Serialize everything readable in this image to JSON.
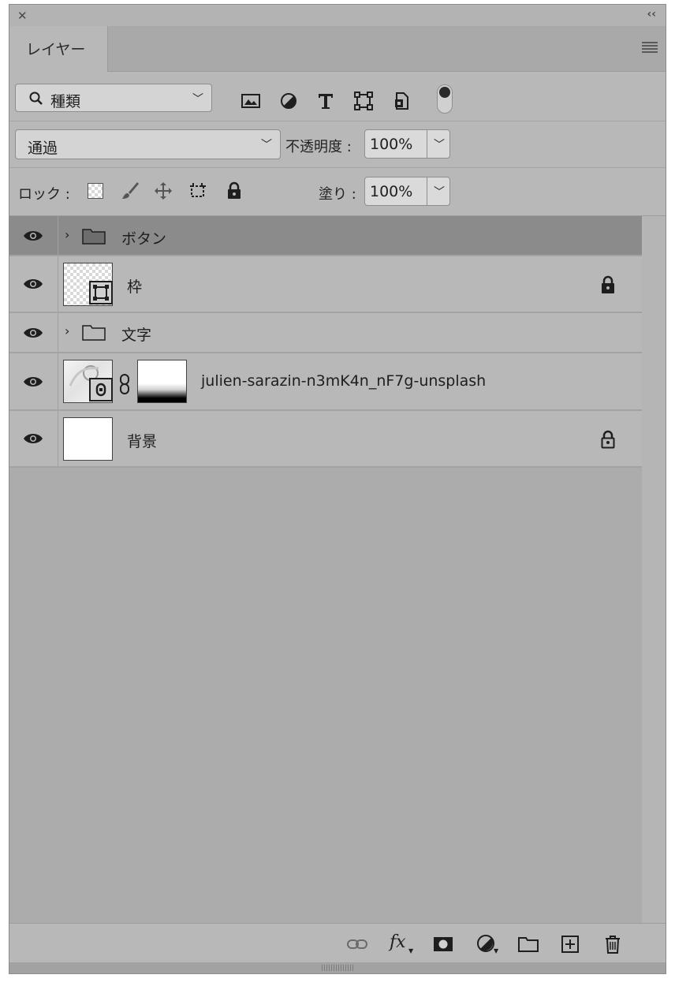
{
  "panel": {
    "title": "レイヤー"
  },
  "filter": {
    "kind_label": "種類",
    "icons": [
      "pixel-filter-icon",
      "adjustment-filter-icon",
      "type-filter-icon",
      "shape-filter-icon",
      "smart-object-filter-icon"
    ]
  },
  "blend": {
    "mode": "通過",
    "opacity_label": "不透明度 :",
    "opacity_value": "100%"
  },
  "lock": {
    "label": "ロック :",
    "fill_label": "塗り :",
    "fill_value": "100%"
  },
  "layers": [
    {
      "name": "ボタン",
      "type": "group",
      "selected": true
    },
    {
      "name": "枠",
      "type": "shape",
      "locked": true
    },
    {
      "name": "文字",
      "type": "group"
    },
    {
      "name": "julien-sarazin-n3mK4n_nF7g-unsplash",
      "type": "smart-object-with-mask"
    },
    {
      "name": "背景",
      "type": "background",
      "locked": true
    }
  ],
  "footer": {
    "fx_label": "fx"
  }
}
